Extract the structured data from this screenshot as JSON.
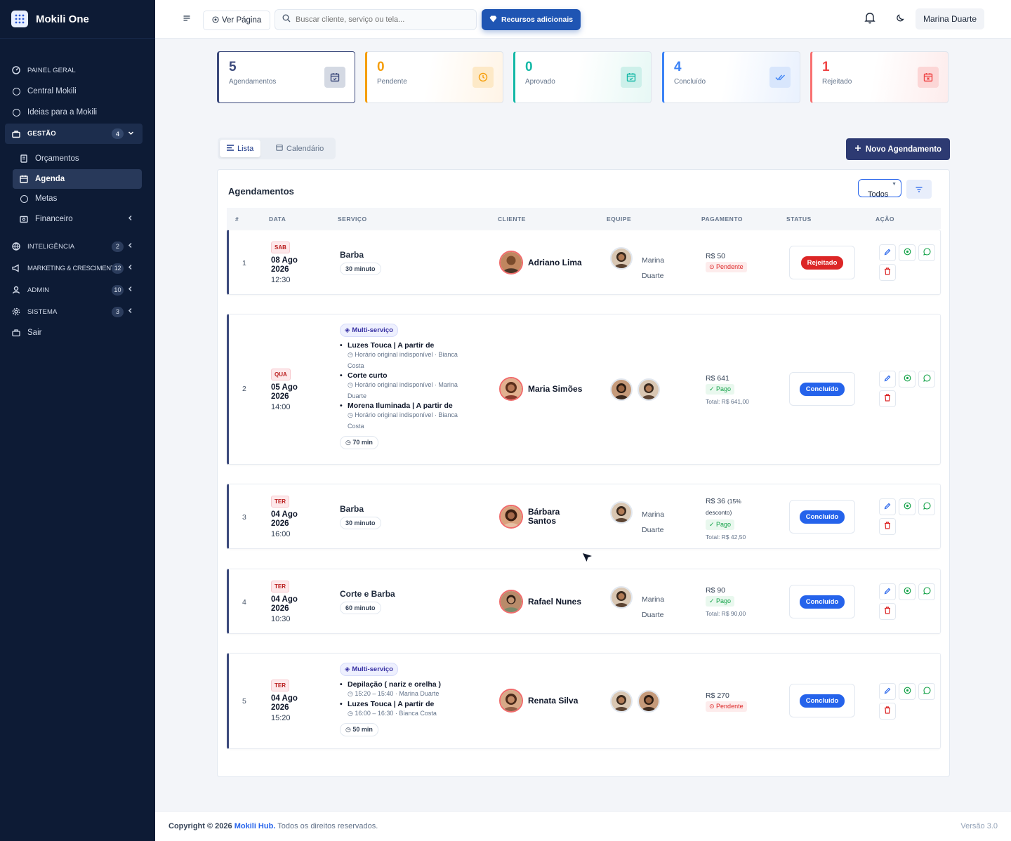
{
  "brand": {
    "name": "Mokili One"
  },
  "sidebar": {
    "items": [
      {
        "label": "PAINEL GERAL"
      },
      {
        "label": "Central Mokili"
      },
      {
        "label": "Ideias para a Mokili"
      },
      {
        "label": "GESTÃO",
        "badge": "4"
      },
      {
        "label": "Orçamentos"
      },
      {
        "label": "Agenda"
      },
      {
        "label": "Metas"
      },
      {
        "label": "Financeiro"
      },
      {
        "label": "INTELIGÊNCIA",
        "badge": "2"
      },
      {
        "label": "MARKETING & CRESCIMENTO",
        "badge": "12"
      },
      {
        "label": "ADMIN",
        "badge": "10"
      },
      {
        "label": "SISTEMA",
        "badge": "3"
      },
      {
        "label": "Sair"
      }
    ]
  },
  "topbar": {
    "ver_pagina": "Ver Página",
    "search_placeholder": "Buscar cliente, serviço ou tela...",
    "recursos": "Recursos adicionais",
    "user": "Marina Duarte"
  },
  "stats": [
    {
      "value": "5",
      "label": "Agendamentos",
      "color": "#3c4a7c"
    },
    {
      "value": "0",
      "label": "Pendente",
      "color": "#f59e0b"
    },
    {
      "value": "0",
      "label": "Aprovado",
      "color": "#14b8a6"
    },
    {
      "value": "4",
      "label": "Concluído",
      "color": "#3b82f6"
    },
    {
      "value": "1",
      "label": "Rejeitado",
      "color": "#f87171"
    }
  ],
  "tabs": {
    "lista": "Lista",
    "calendario": "Calendário"
  },
  "new_button": "Novo Agendamento",
  "card": {
    "title": "Agendamentos",
    "filter_value": "Todos",
    "columns": [
      "#",
      "DATA",
      "SERVIÇO",
      "CLIENTE",
      "EQUIPE",
      "PAGAMENTO",
      "STATUS",
      "AÇÃO"
    ]
  },
  "rows": [
    {
      "n": "1",
      "day": "SAB",
      "date": "08 Ago 2026",
      "time": "12:30",
      "service": "Barba",
      "duration": "30 minuto",
      "client": "Adriano Lima",
      "team": "Marina Duarte",
      "amount": "R$ 50",
      "pay_status": "Pendente",
      "status": "Rejeitado"
    },
    {
      "n": "2",
      "day": "QUA",
      "date": "05 Ago 2026",
      "time": "14:00",
      "multi": "Multi-serviço",
      "subs": [
        {
          "name": "Luzes Touca | A partir de",
          "note": "Horário original indisponível · Bianca Costa"
        },
        {
          "name": "Corte curto",
          "note": "Horário original indisponível · Marina Duarte"
        },
        {
          "name": "Morena Iluminada | A partir de",
          "note": "Horário original indisponível · Bianca Costa"
        }
      ],
      "duration": "70 min",
      "client": "Maria Simões",
      "amount": "R$ 641",
      "pay_status": "Pago",
      "total": "Total: R$ 641,00",
      "status": "Concluído"
    },
    {
      "n": "3",
      "day": "TER",
      "date": "04 Ago 2026",
      "time": "16:00",
      "service": "Barba",
      "duration": "30 minuto",
      "client": "Bárbara Santos",
      "team": "Marina Duarte",
      "amount": "R$ 36",
      "discount": "(15% desconto)",
      "pay_status": "Pago",
      "total": "Total: R$ 42,50",
      "status": "Concluído"
    },
    {
      "n": "4",
      "day": "TER",
      "date": "04 Ago 2026",
      "time": "10:30",
      "service": "Corte e Barba",
      "duration": "60 minuto",
      "client": "Rafael Nunes",
      "team": "Marina Duarte",
      "amount": "R$ 90",
      "pay_status": "Pago",
      "total": "Total: R$ 90,00",
      "status": "Concluído"
    },
    {
      "n": "5",
      "day": "TER",
      "date": "04 Ago 2026",
      "time": "15:20",
      "multi": "Multi-serviço",
      "subs": [
        {
          "name": "Depilação ( nariz e orelha )",
          "note": "15:20 – 15:40 · Marina Duarte"
        },
        {
          "name": "Luzes Touca | A partir de",
          "note": "16:00 – 16:30 · Bianca Costa"
        }
      ],
      "duration": "50 min",
      "client": "Renata Silva",
      "amount": "R$ 270",
      "pay_status": "Pendente",
      "status": "Concluído"
    }
  ],
  "footer": {
    "copyright": "Copyright © 2026",
    "brand": "Mokili Hub.",
    "rights": "Todos os direitos reservados.",
    "version": "Versão 3.0"
  }
}
